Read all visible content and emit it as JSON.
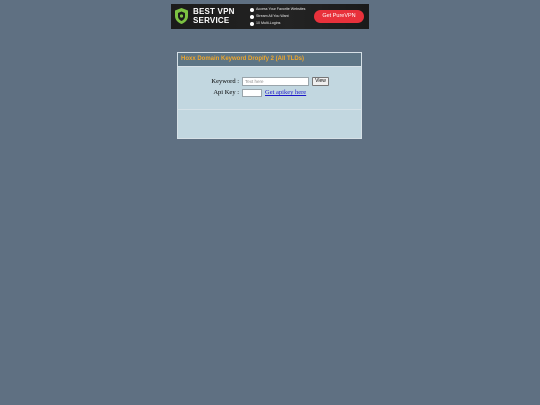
{
  "banner": {
    "headline_line1": "BEST VPN",
    "headline_line2": "SERVICE",
    "features": [
      "Access Your Favorite Websites",
      "Stream All You Want",
      "10 Multi-Logins"
    ],
    "cta_label": "Get PureVPN",
    "brand_color": "#e8313b",
    "shield_color": "#7cc242"
  },
  "panel": {
    "title": "Hoxx Domain Keyword Dropify 2 (All TLDs)",
    "header_color": "#f0a629",
    "keyword_label": "Keyword :",
    "keyword_value": "",
    "keyword_placeholder": "Text here",
    "view_button_label": "View",
    "apikey_label": "Api Key :",
    "apikey_value": "",
    "apikey_link_text": "Get apikey here"
  }
}
